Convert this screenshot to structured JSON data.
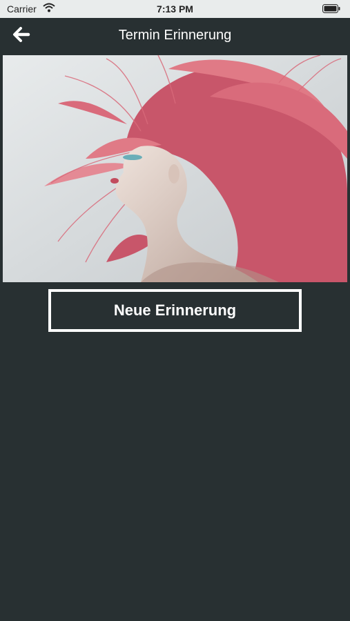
{
  "status_bar": {
    "carrier": "Carrier",
    "time": "7:13 PM",
    "wifi_icon": "wifi-icon",
    "battery_icon": "battery-icon"
  },
  "nav": {
    "title": "Termin Erinnerung",
    "back_icon": "arrow-left-icon"
  },
  "hero": {
    "description_icon": "portrait-photo"
  },
  "action": {
    "new_reminder_label": "Neue Erinnerung"
  },
  "colors": {
    "background": "#283032",
    "status_bar": "#e9ecec",
    "hair_accent": "#e07a86",
    "button_border": "#ffffff"
  }
}
